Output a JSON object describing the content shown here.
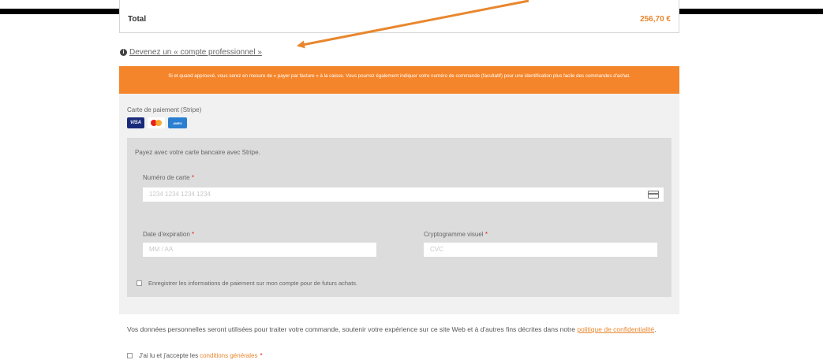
{
  "order": {
    "total_label": "Total",
    "total_value": "256,70 €"
  },
  "pro_account": {
    "icon": "info-icon",
    "link_text": "Devenez un « compte professionnel »"
  },
  "notice": {
    "text": "Si et quand approuvé, vous serez en mesure de « payer par facture » à la caisse. Vous pourrez également indiquer votre numéro de commande (facultatif) pour une identification plus facile des commandes d'achat."
  },
  "payment": {
    "method_label": "Carte de paiement (Stripe)",
    "cards": [
      "VISA",
      "mastercard",
      "AMERICAN EXPRESS"
    ],
    "intro": "Payez avec votre carte bancaire avec Stripe.",
    "card_number": {
      "label": "Numéro de carte",
      "required": "*",
      "placeholder": "1234 1234 1234 1234",
      "value": ""
    },
    "expiry": {
      "label": "Date d'expiration",
      "required": "*",
      "placeholder": "MM / AA",
      "value": ""
    },
    "cvc": {
      "label": "Cryptogramme visuel",
      "required": "*",
      "placeholder": "CVC",
      "value": ""
    },
    "save_label": "Enregistrer les informations de paiement sur mon compte pour de futurs achats.",
    "save_checked": false
  },
  "privacy": {
    "text": "Vos données personnelles seront utilisées pour traiter votre commande, soutenir votre expérience sur ce site Web et à d'autres fins décrites dans notre ",
    "link_text": "politique de confidentialité",
    "end": "."
  },
  "terms": {
    "label": "J'ai lu et j'accepte les ",
    "link_text": "conditions générales",
    "required": "*",
    "checked": false
  },
  "colors": {
    "accent": "#f5852a",
    "link": "#e8872e",
    "arrow": "#e8872e",
    "panel": "#f1f1f1",
    "stripe_panel": "#dcdcdc"
  }
}
